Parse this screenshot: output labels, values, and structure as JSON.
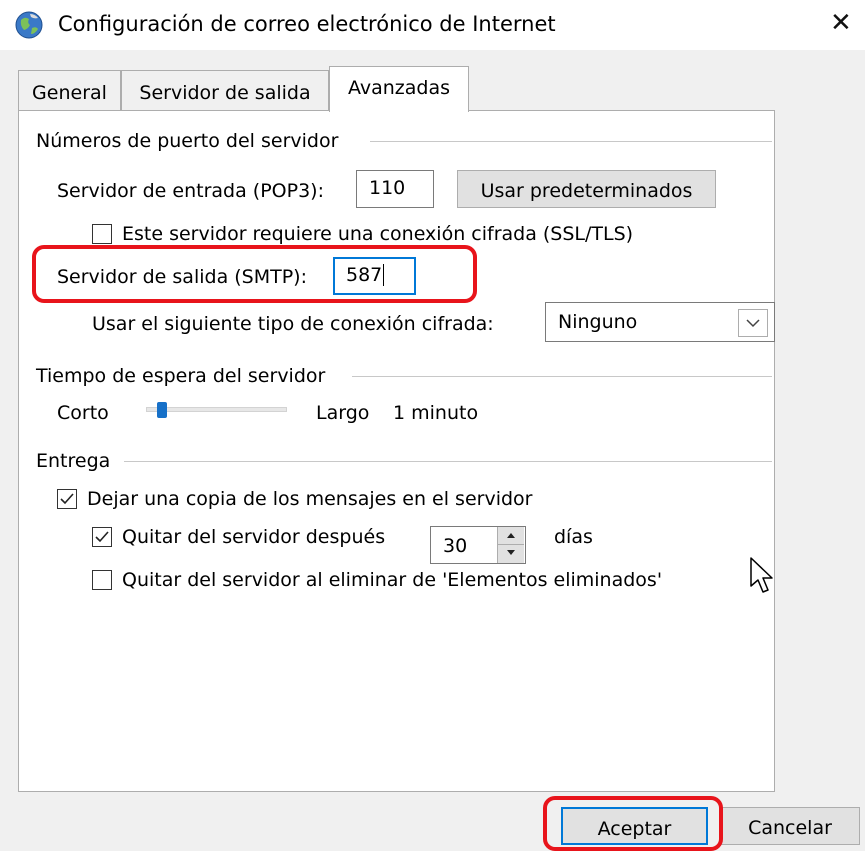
{
  "window": {
    "title": "Configuración de correo electrónico de Internet",
    "close_glyph": "✕"
  },
  "tabs": [
    {
      "label": "General",
      "active": false
    },
    {
      "label": "Servidor de salida",
      "active": false
    },
    {
      "label": "Avanzadas",
      "active": true
    }
  ],
  "ports": {
    "section_title": "Números de puerto del servidor",
    "incoming_label": "Servidor de entrada (POP3):",
    "incoming_value": "110",
    "defaults_button": "Usar predeterminados",
    "ssl_checkbox_label": "Este servidor requiere una conexión cifrada (SSL/TLS)",
    "ssl_checked": false,
    "outgoing_label": "Servidor de salida (SMTP):",
    "outgoing_value": "587",
    "encryption_label": "Usar el siguiente tipo de conexión cifrada:",
    "encryption_value": "Ninguno"
  },
  "timeout": {
    "section_title": "Tiempo de espera del servidor",
    "short_label": "Corto",
    "long_label": "Largo",
    "value_label": "1 minuto",
    "level_fraction": 0.08
  },
  "delivery": {
    "section_title": "Entrega",
    "leave_copy_label": "Dejar una copia de los mensajes en el servidor",
    "leave_copy_checked": true,
    "remove_after_label": "Quitar del servidor después",
    "remove_after_checked": true,
    "remove_after_days": "30",
    "days_label": "días",
    "remove_on_delete_label": "Quitar del servidor al eliminar de 'Elementos eliminados'",
    "remove_on_delete_checked": false
  },
  "footer": {
    "ok_button": "Aceptar",
    "cancel_button": "Cancelar"
  },
  "colors": {
    "highlight": "#e8141b",
    "accent": "#0078d7",
    "dialog_bg": "#f0f0f0"
  },
  "icons": {
    "app": "internet-globe-icon",
    "close": "close-icon",
    "checkmark": "checkmark-icon",
    "dropdown": "chevron-down-icon",
    "spin_up": "spin-up-arrow-icon",
    "spin_down": "spin-down-arrow-icon",
    "cursor": "mouse-pointer-icon"
  }
}
